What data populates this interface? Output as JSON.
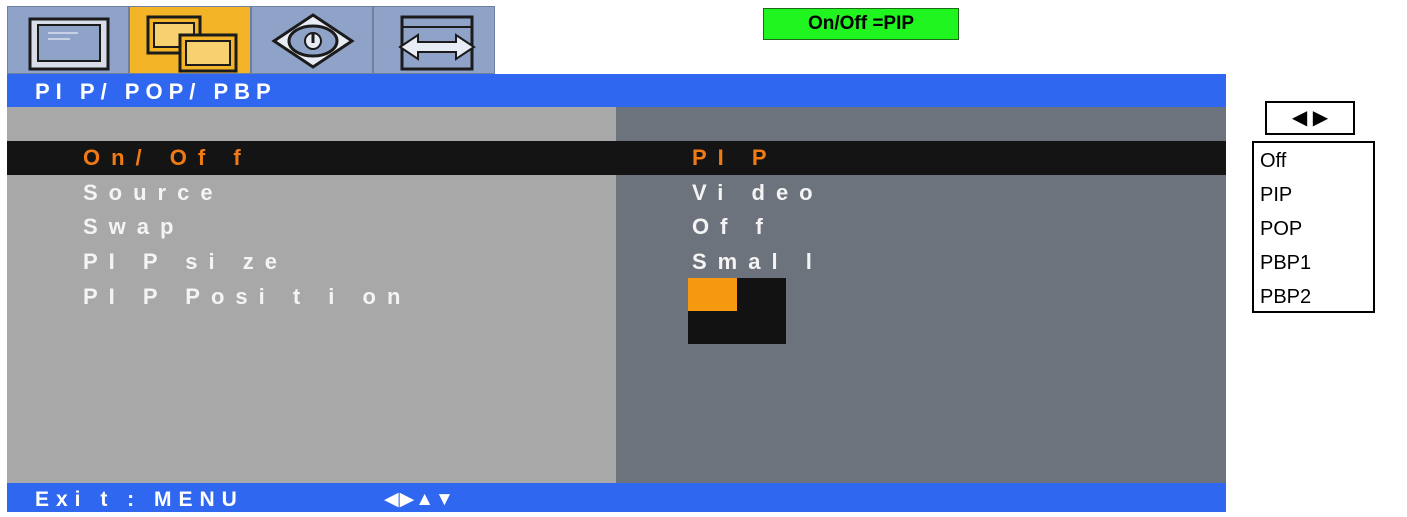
{
  "tabs": [
    {
      "icon": "monitor-icon",
      "active": false
    },
    {
      "icon": "pip-windows-icon",
      "active": true
    },
    {
      "icon": "eye-icon",
      "active": false
    },
    {
      "icon": "resize-arrows-icon",
      "active": false
    }
  ],
  "status_indicator": "On/Off =PIP",
  "menu": {
    "title": "PI P/ POP/ PBP",
    "items": [
      {
        "label": "On/ Of f",
        "value": "PI P",
        "selected": true
      },
      {
        "label": "Source",
        "value": "Vi deo"
      },
      {
        "label": "Swap",
        "value": "Of f"
      },
      {
        "label": "PI P si ze",
        "value": "Smal l"
      },
      {
        "label": "PI P Posi t i on",
        "value_icon": "pip-position-preview"
      }
    ]
  },
  "footer": {
    "exit": "Exi t : MENU",
    "nav_arrows": "◀▶▲▼"
  },
  "side": {
    "arrows": "◀ ▶",
    "options": [
      "Off",
      "PIP",
      "POP",
      "PBP1",
      "PBP2"
    ]
  },
  "colors": {
    "title_bar": "#2f67f0",
    "active_tab": "#f3b428",
    "selected_text": "#f07a14",
    "indicator": "#20f520",
    "pip_corner": "#f59a10"
  }
}
